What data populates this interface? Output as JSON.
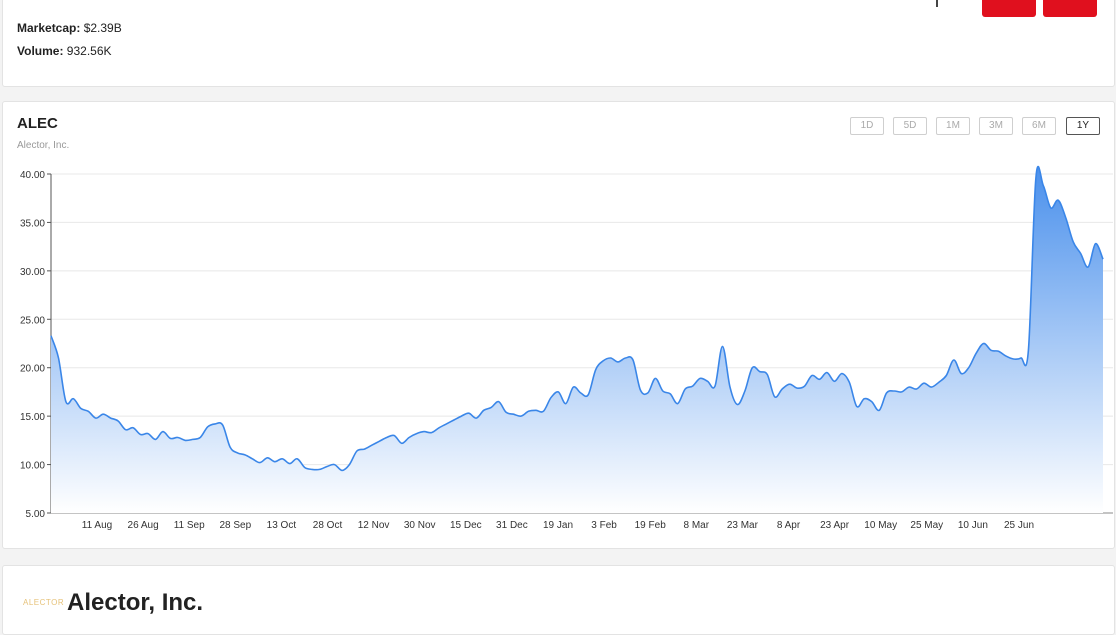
{
  "stats": {
    "marketcap_label": "Marketcap:",
    "marketcap_value": "$2.39B",
    "volume_label": "Volume:",
    "volume_value": "932.56K"
  },
  "header_buttons": {
    "accent_color": "#e0101e"
  },
  "chart_header": {
    "ticker": "ALEC",
    "company": "Alector, Inc.",
    "ranges": [
      "1D",
      "5D",
      "1M",
      "3M",
      "6M",
      "1Y"
    ],
    "active_range": "1Y"
  },
  "profile": {
    "logo_text": "ALECTOR",
    "name": "Alector, Inc."
  },
  "chart_data": {
    "type": "area",
    "title": "",
    "xlabel": "",
    "ylabel": "",
    "ylim": [
      5,
      40
    ],
    "y_ticks": [
      "5.00",
      "10.00",
      "15.00",
      "20.00",
      "25.00",
      "30.00",
      "35.00",
      "40.00"
    ],
    "x_ticks": [
      "11 Aug",
      "26 Aug",
      "11 Sep",
      "28 Sep",
      "13 Oct",
      "28 Oct",
      "12 Nov",
      "30 Nov",
      "15 Dec",
      "31 Dec",
      "19 Jan",
      "3 Feb",
      "19 Feb",
      "8 Mar",
      "23 Mar",
      "8 Apr",
      "23 Apr",
      "10 May",
      "25 May",
      "10 Jun",
      "25 Jun"
    ],
    "grid": true,
    "line_color": "#3a86e8",
    "fill_top_color": "#4a90ec",
    "fill_bottom_color": "#ffffff",
    "series": [
      {
        "values": [
          23.3,
          21.0,
          16.5,
          16.8,
          15.8,
          15.5,
          14.8,
          15.2,
          14.8,
          14.5,
          13.6,
          13.8,
          13.1,
          13.2,
          12.6,
          13.4,
          12.7,
          12.8,
          12.5,
          12.6,
          12.8,
          13.9,
          14.2,
          14.1,
          11.8,
          11.2,
          11.0,
          10.6,
          10.2,
          10.7,
          10.3,
          10.6,
          10.1,
          10.6,
          9.7,
          9.5,
          9.5,
          9.8,
          10.0,
          9.4,
          10.0,
          11.4,
          11.6,
          12.0,
          12.4,
          12.8,
          13.0,
          12.2,
          12.8,
          13.2,
          13.4,
          13.3,
          13.8,
          14.2,
          14.6,
          15.0,
          15.3,
          14.8,
          15.6,
          15.9,
          16.5,
          15.4,
          15.2,
          15.0,
          15.5,
          15.6,
          15.5,
          16.9,
          17.5,
          16.3,
          18.0,
          17.4,
          17.2,
          19.8,
          20.7,
          21.0,
          20.6,
          21.0,
          20.8,
          17.7,
          17.4,
          18.9,
          17.6,
          17.3,
          16.3,
          17.8,
          18.1,
          18.9,
          18.6,
          18.1,
          22.2,
          18.0,
          16.2,
          17.6,
          20.0,
          19.6,
          19.3,
          17.0,
          17.8,
          18.3,
          17.9,
          18.1,
          19.2,
          18.8,
          19.5,
          18.6,
          19.4,
          18.5,
          16.0,
          16.8,
          16.5,
          15.6,
          17.4,
          17.6,
          17.5,
          18.0,
          17.8,
          18.4,
          18.0,
          18.5,
          19.2,
          20.8,
          19.4,
          20.0,
          21.5,
          22.5,
          21.8,
          21.7,
          21.2,
          20.9,
          21.0,
          21.8,
          39.6,
          38.8,
          36.5,
          37.3,
          35.5,
          33.0,
          31.8,
          30.4,
          32.8,
          31.2
        ]
      }
    ]
  }
}
